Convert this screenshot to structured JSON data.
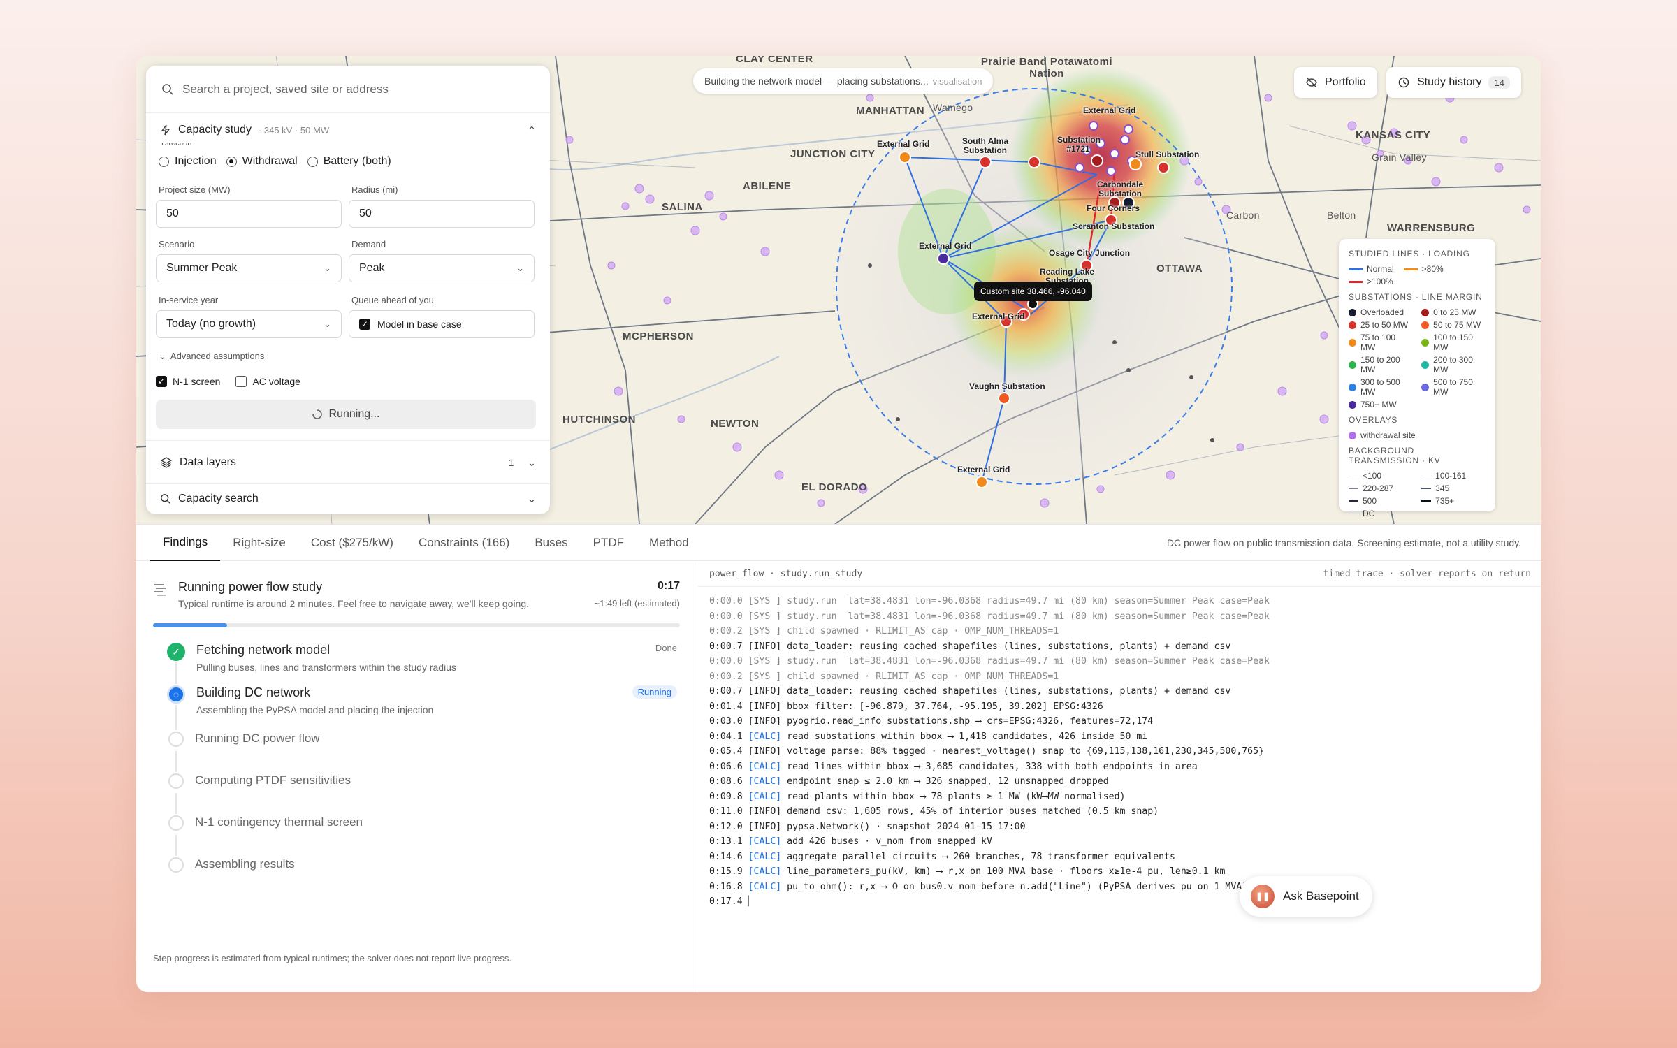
{
  "map": {
    "status_text": "Building the network model — placing substations...",
    "status_muted": "visualisation",
    "portfolio_label": "Portfolio",
    "history_label": "Study history",
    "history_count": "14",
    "tooltip": "Custom site 38.466, -96.040",
    "places": [
      "CLAY CENTER",
      "Prairie Band Potawatomi Nation",
      "MANHATTAN",
      "Wamego",
      "JUNCTION CITY",
      "ABILENE",
      "SALINA",
      "KANSAS CITY",
      "Grain Valley",
      "Belton",
      "WARRENSBURG",
      "OTTAWA",
      "MCPHERSON",
      "HUTCHINSON",
      "NEWTON",
      "EL DORADO",
      "Carbon"
    ],
    "substations": [
      "External Grid",
      "South Alma Substation",
      "Substation #1721",
      "External Grid",
      "Stull Substation",
      "Carbondale Substation",
      "Four Corners",
      "Scranton Substation",
      "External Grid",
      "Osage City Junction",
      "Reading Lake Substation",
      "External Grid",
      "Vaughn Substation",
      "External Grid"
    ]
  },
  "legend": {
    "lines_title": "STUDIED LINES · LOADING",
    "lines": [
      {
        "label": "Normal",
        "color": "#2f6fe0"
      },
      {
        "label": ">80%",
        "color": "#f28c1a"
      },
      {
        "label": ">100%",
        "color": "#e0262b"
      }
    ],
    "subs_title": "SUBSTATIONS · LINE MARGIN",
    "subs": [
      {
        "label": "Overloaded",
        "color": "#151a2e"
      },
      {
        "label": "0 to 25 MW",
        "color": "#a51c1c"
      },
      {
        "label": "25 to 50 MW",
        "color": "#d6312b"
      },
      {
        "label": "50 to 75 MW",
        "color": "#f05a22"
      },
      {
        "label": "75 to 100 MW",
        "color": "#f08a1c"
      },
      {
        "label": "100 to 150 MW",
        "color": "#7cb518"
      },
      {
        "label": "150 to 200 MW",
        "color": "#2bb24c"
      },
      {
        "label": "200 to 300 MW",
        "color": "#1fb5a3"
      },
      {
        "label": "300 to 500 MW",
        "color": "#2f7fe0"
      },
      {
        "label": "500 to 750 MW",
        "color": "#6a67e0"
      },
      {
        "label": "750+ MW",
        "color": "#4a2a9e"
      }
    ],
    "overlays_title": "OVERLAYS",
    "overlay_item": {
      "label": "withdrawal site",
      "color": "#b26ee8"
    },
    "bg_title": "BACKGROUND TRANSMISSION · KV",
    "bg": [
      {
        "label": "<100",
        "color": "#c9ccd4",
        "w": 1
      },
      {
        "label": "100-161",
        "color": "#9aa1b0",
        "w": 1
      },
      {
        "label": "220-287",
        "color": "#7b8496",
        "w": 2
      },
      {
        "label": "345",
        "color": "#4a5366",
        "w": 2
      },
      {
        "label": "500",
        "color": "#252b3a",
        "w": 3
      },
      {
        "label": "735+",
        "color": "#0d0f16",
        "w": 4
      },
      {
        "label": "DC",
        "color": "#8a93a6",
        "w": 1
      }
    ]
  },
  "panel": {
    "search_placeholder": "Search a project, saved site or address",
    "study_title": "Capacity study",
    "study_sub": "· 345 kV · 50 MW",
    "direction_label": "Direction",
    "direction_options": [
      "Injection",
      "Withdrawal",
      "Battery (both)"
    ],
    "direction_selected": "Withdrawal",
    "project_size_label": "Project size (MW)",
    "project_size": "50",
    "radius_label": "Radius (mi)",
    "radius": "50",
    "scenario_label": "Scenario",
    "scenario": "Summer Peak",
    "demand_label": "Demand",
    "demand": "Peak",
    "year_label": "In-service year",
    "year": "Today (no growth)",
    "queue_label": "Queue ahead of you",
    "queue_option": "Model in base case",
    "advanced": "Advanced assumptions",
    "n1": "N-1 screen",
    "ac": "AC voltage",
    "run": "Running...",
    "layers": "Data layers",
    "layers_count": "1",
    "capsearch": "Capacity search"
  },
  "tabs": [
    "Findings",
    "Right-size",
    "Cost ($275/kW)",
    "Constraints (166)",
    "Buses",
    "PTDF",
    "Method"
  ],
  "tabs_note": "DC power flow on public transmission data. Screening estimate, not a utility study.",
  "progress": {
    "title": "Running power flow study",
    "sub": "Typical runtime is around 2 minutes. Feel free to navigate away, we'll keep going.",
    "elapsed": "0:17",
    "remaining": "~1:49 left (estimated)",
    "fraction": 0.14,
    "steps": [
      {
        "title": "Fetching network model",
        "sub": "Pulling buses, lines and transformers within the study radius",
        "state": "done",
        "badge": "Done"
      },
      {
        "title": "Building DC network",
        "sub": "Assembling the PyPSA model and placing the injection",
        "state": "running",
        "badge": "Running"
      },
      {
        "title": "Running DC power flow",
        "sub": "",
        "state": "pending",
        "badge": ""
      },
      {
        "title": "Computing PTDF sensitivities",
        "sub": "",
        "state": "pending",
        "badge": ""
      },
      {
        "title": "N-1 contingency thermal screen",
        "sub": "",
        "state": "pending",
        "badge": ""
      },
      {
        "title": "Assembling results",
        "sub": "",
        "state": "pending",
        "badge": ""
      }
    ],
    "footnote": "Step progress is estimated from typical runtimes; the solver does not report live progress."
  },
  "log": {
    "head_left": "power_flow · study.run_study",
    "head_right": "timed trace · solver reports on return",
    "lines": [
      {
        "t": "0:00.0",
        "tag": "SYS",
        "msg": "study.run  lat=38.4831 lon=-96.0368 radius=49.7 mi (80 km) season=Summer Peak case=Peak"
      },
      {
        "t": "0:00.0",
        "tag": "SYS",
        "msg": "study.run  lat=38.4831 lon=-96.0368 radius=49.7 mi (80 km) season=Summer Peak case=Peak"
      },
      {
        "t": "0:00.2",
        "tag": "SYS",
        "msg": "child spawned · RLIMIT_AS cap · OMP_NUM_THREADS=1"
      },
      {
        "t": "0:00.7",
        "tag": "INFO",
        "msg": "data_loader: reusing cached shapefiles (lines, substations, plants) + demand csv"
      },
      {
        "t": "0:00.0",
        "tag": "SYS",
        "msg": "study.run  lat=38.4831 lon=-96.0368 radius=49.7 mi (80 km) season=Summer Peak case=Peak"
      },
      {
        "t": "0:00.2",
        "tag": "SYS",
        "msg": "child spawned · RLIMIT_AS cap · OMP_NUM_THREADS=1"
      },
      {
        "t": "0:00.7",
        "tag": "INFO",
        "msg": "data_loader: reusing cached shapefiles (lines, substations, plants) + demand csv"
      },
      {
        "t": "0:01.4",
        "tag": "INFO",
        "msg": "bbox filter: [-96.879, 37.764, -95.195, 39.202] EPSG:4326"
      },
      {
        "t": "0:03.0",
        "tag": "INFO",
        "msg": "pyogrio.read_info substations.shp ⟶ crs=EPSG:4326, features=72,174"
      },
      {
        "t": "0:04.1",
        "tag": "CALC",
        "msg": "read substations within bbox ⟶ 1,418 candidates, 426 inside 50 mi"
      },
      {
        "t": "0:05.4",
        "tag": "INFO",
        "msg": "voltage parse: 88% tagged · nearest_voltage() snap to {69,115,138,161,230,345,500,765}"
      },
      {
        "t": "0:06.6",
        "tag": "CALC",
        "msg": "read lines within bbox ⟶ 3,685 candidates, 338 with both endpoints in area"
      },
      {
        "t": "0:08.6",
        "tag": "CALC",
        "msg": "endpoint snap ≤ 2.0 km ⟶ 326 snapped, 12 unsnapped dropped"
      },
      {
        "t": "0:09.8",
        "tag": "CALC",
        "msg": "read plants within bbox ⟶ 78 plants ≥ 1 MW (kW⟶MW normalised)"
      },
      {
        "t": "0:11.0",
        "tag": "INFO",
        "msg": "demand csv: 1,605 rows, 45% of interior buses matched (0.5 km snap)"
      },
      {
        "t": "0:12.0",
        "tag": "INFO",
        "msg": "pypsa.Network() · snapshot 2024-01-15 17:00"
      },
      {
        "t": "0:13.1",
        "tag": "CALC",
        "msg": "add 426 buses · v_nom from snapped kV"
      },
      {
        "t": "0:14.6",
        "tag": "CALC",
        "msg": "aggregate parallel circuits ⟶ 260 branches, 78 transformer equivalents"
      },
      {
        "t": "0:15.9",
        "tag": "CALC",
        "msg": "line_parameters_pu(kV, km) ⟶ r,x on 100 MVA base · floors x≥1e-4 pu, len≥0.1 km"
      },
      {
        "t": "0:16.8",
        "tag": "CALC",
        "msg": "pu_to_ohm(): r,x ⟶ Ω on bus0.v_nom before n.add(\"Line\") (PyPSA derives pu on 1 MVA)"
      }
    ],
    "cursor_time": "0:17.4"
  },
  "ask": "Ask Basepoint"
}
